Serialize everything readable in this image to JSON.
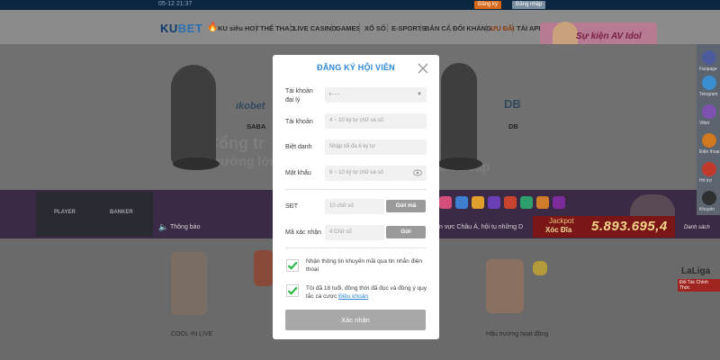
{
  "topbar": {
    "time": "05-12 21:37",
    "register_label": "Đăng ký",
    "login_label": "Đăng nhập"
  },
  "nav": {
    "logo": "KUBET",
    "items": [
      "KU siêu HOT",
      "THỂ THAO",
      "LIVE CASINO",
      "GAMES",
      "XỔ SỐ",
      "E-SPORTS",
      "BẮN CÁ",
      "ĐỐI KHÁNG",
      "ƯU ĐÃI",
      "TẢI APP"
    ],
    "active_item": "ƯU ĐÃI",
    "promo_text": "Sự kiện AV Idol"
  },
  "banner": {
    "providers": [
      {
        "logo": "ıkobet",
        "label": "SABA"
      },
      {
        "logo": "DB",
        "label": "DB"
      }
    ],
    "ghost_texts": [
      "Cổng tr",
      "thưởng lớn",
      "siêu cấp"
    ]
  },
  "strip": {
    "table_labels": [
      "PLAYER",
      "BANKER"
    ],
    "notice_label": "Thông báo",
    "marquee": "n vực Châu Á, hội tụ những D",
    "jackpot": {
      "line1": "Jackpot",
      "line2": "Xóc Đĩa",
      "value": "5.893.695,4"
    },
    "dealer_label": "Danh sách"
  },
  "bottom": {
    "labels": [
      "COOL-IN LIVE",
      "Hậu trường hoạt động"
    ],
    "laliga": "LaLiga",
    "laliga_sub": "Đối Tác Chính Thức"
  },
  "side_tools": [
    {
      "label": "Fanpage",
      "color": "#4a5a9a"
    },
    {
      "label": "Telegram",
      "color": "#3a8fd0"
    },
    {
      "label": "Viber",
      "color": "#7d52b0"
    },
    {
      "label": "Điện thoại",
      "color": "#d0791e"
    },
    {
      "label": "Hỗ trợ",
      "color": "#c0392b"
    },
    {
      "label": "Khuyến",
      "color": "#303030"
    }
  ],
  "modal": {
    "title": "ĐĂNG KÝ HỘI VIÊN",
    "fields": {
      "agent": {
        "label": "Tài khoản đại lý",
        "value": "ı·····"
      },
      "account": {
        "label": "Tài khoản",
        "placeholder": "4 ~ 10 ký tự chữ và số"
      },
      "nickname": {
        "label": "Biệt danh",
        "placeholder": "Nhập tối đa 6 ký tự"
      },
      "password": {
        "label": "Mật khẩu",
        "placeholder": "6 ~ 10 ký tự chữ và số"
      },
      "phone": {
        "label": "SĐT",
        "placeholder": "10 chữ số",
        "button": "Gửi mã"
      },
      "code": {
        "label": "Mã xác nhận",
        "placeholder": "4 Chữ số",
        "button": "Gửi"
      }
    },
    "check1": "Nhận thông tin khuyến mãi qua tin nhắn điện thoại",
    "check2_text": "Tôi đã 18 tuổi, đồng thời đã đọc và đồng ý quy tắc cá cược",
    "check2_link": "Điều khoản",
    "submit": "Xác nhận"
  },
  "colors": {
    "accent": "#2f86d4",
    "check": "#2db84a",
    "overlay": "#6e6e6e"
  }
}
